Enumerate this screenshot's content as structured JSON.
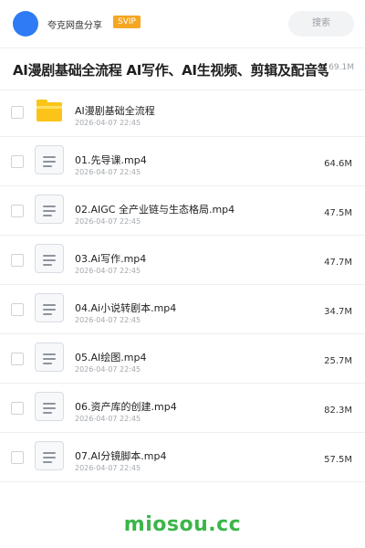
{
  "header": {
    "site_name": "夸克网盘分享",
    "badge": "SVIP",
    "search_label": "搜索"
  },
  "folder": {
    "title": "AI漫剧基础全流程 AI写作、AI生视频、剪辑及配音等",
    "total_size": "69.1M"
  },
  "items": [
    {
      "name": "AI漫剧基础全流程",
      "date": "2026-04-07 22:45",
      "size": "",
      "type": "folder-icon"
    },
    {
      "name": "01.先导课.mp4",
      "date": "2026-04-07 22:45",
      "size": "64.6M",
      "type": "file-icon"
    },
    {
      "name": "02.AIGC 全产业链与生态格局.mp4",
      "date": "2026-04-07 22:45",
      "size": "47.5M",
      "type": "file-icon"
    },
    {
      "name": "03.Ai写作.mp4",
      "date": "2026-04-07 22:45",
      "size": "47.7M",
      "type": "file-icon"
    },
    {
      "name": "04.Ai小说转剧本.mp4",
      "date": "2026-04-07 22:45",
      "size": "34.7M",
      "type": "file-icon"
    },
    {
      "name": "05.AI绘图.mp4",
      "date": "2026-04-07 22:45",
      "size": "25.7M",
      "type": "file-icon"
    },
    {
      "name": "06.资产库的创建.mp4",
      "date": "2026-04-07 22:45",
      "size": "82.3M",
      "type": "file-icon"
    },
    {
      "name": "07.AI分镜脚本.mp4",
      "date": "2026-04-07 22:45",
      "size": "57.5M",
      "type": "file-icon"
    }
  ],
  "footer": {
    "brand": "miosou.cc"
  },
  "colors": {
    "accent": "#2f7bf5",
    "svip": "#f5a623",
    "folder": "#fcc419",
    "brand": "#3cb54a"
  }
}
